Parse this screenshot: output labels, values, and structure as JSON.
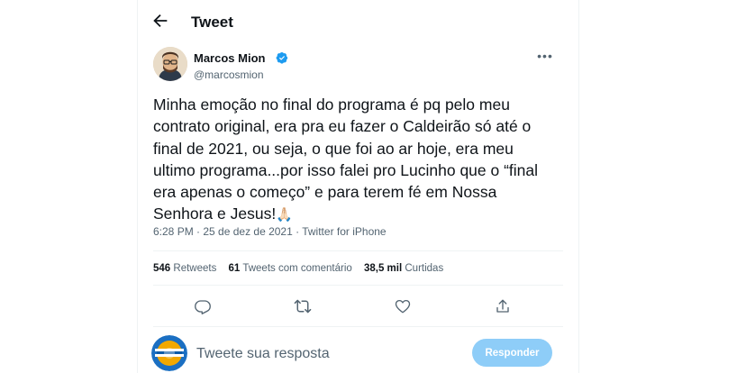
{
  "header": {
    "back_icon": "arrow-left-icon",
    "title": "Tweet"
  },
  "author": {
    "name": "Marcos Mion",
    "handle": "@marcosmion",
    "verified": true,
    "verified_color": "#1d9bf0"
  },
  "tweet": {
    "text": "Minha emoção no final do programa é pq pelo meu\ncontrato original, era pra eu fazer o Caldeirão só até o\nfinal de 2021, ou seja, o que foi ao ar hoje, era meu\nultimo programa...por isso falei pro Lucinho que o “final\nera apenas o começo” e para terem fé em Nossa\nSenhora e Jesus!",
    "emoji": "🙏🏻",
    "meta": "6:28 PM · 25 de dez de 2021 · Twitter for iPhone"
  },
  "stats": {
    "retweets_count": "546",
    "retweets_label": "Retweets",
    "quotes_count": "61",
    "quotes_label": "Tweets com comentário",
    "likes_count": "38,5 mil",
    "likes_label": "Curtidas"
  },
  "actions": [
    "reply-icon",
    "retweet-icon",
    "like-icon",
    "share-icon"
  ],
  "reply": {
    "placeholder": "Tweete sua resposta",
    "button_label": "Responder",
    "button_color": "#8ecdf8"
  },
  "colors": {
    "text": "#0f1419",
    "secondary": "#536471",
    "divider": "#eff3f4"
  }
}
